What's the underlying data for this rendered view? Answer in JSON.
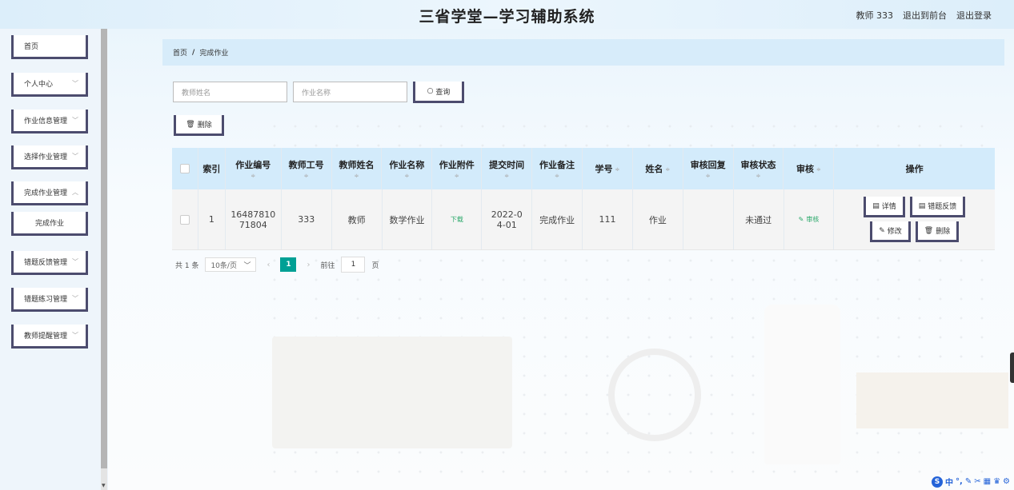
{
  "header": {
    "title": "三省学堂—学习辅助系统",
    "user": "教师 333",
    "back_to_front": "退出到前台",
    "logout": "退出登录"
  },
  "sidebar": {
    "items": [
      {
        "label": "首页"
      },
      {
        "label": "个人中心"
      },
      {
        "label": "作业信息管理"
      },
      {
        "label": "选择作业管理"
      },
      {
        "label": "完成作业管理"
      },
      {
        "label": "完成作业"
      },
      {
        "label": "错题反馈管理"
      },
      {
        "label": "错题练习管理"
      },
      {
        "label": "教师提醒管理"
      }
    ]
  },
  "breadcrumb": {
    "home": "首页",
    "separator": "/",
    "current": "完成作业"
  },
  "search": {
    "teacher_name_placeholder": "教师姓名",
    "homework_name_placeholder": "作业名称",
    "query_label": "查询",
    "delete_label": "删除"
  },
  "table": {
    "headers": [
      "索引",
      "作业编号",
      "教师工号",
      "教师姓名",
      "作业名称",
      "作业附件",
      "提交时间",
      "作业备注",
      "学号",
      "姓名",
      "审核回复",
      "审核状态",
      "审核",
      "操作"
    ],
    "row": {
      "index": "1",
      "homework_no": "1648781071804",
      "teacher_no": "333",
      "teacher_name": "教师",
      "homework_name": "数学作业",
      "attachment": "下载",
      "submit_time": "2022-04-01",
      "remark": "完成作业",
      "student_no": "111",
      "student_name": "作业",
      "audit_reply": "",
      "audit_status": "未通过",
      "audit_link": "审核"
    },
    "ops": {
      "detail": "详情",
      "feedback": "错题反馈",
      "edit": "修改",
      "delete": "删除"
    }
  },
  "pagination": {
    "total": "共 1 条",
    "page_size": "10条/页",
    "current_page": "1",
    "goto_prefix": "前往",
    "goto_value": "1",
    "goto_suffix": "页"
  },
  "colors": {
    "accent": "#00a095",
    "header_bg": "#d3ebfb",
    "button_border": "#4c4c6e"
  }
}
